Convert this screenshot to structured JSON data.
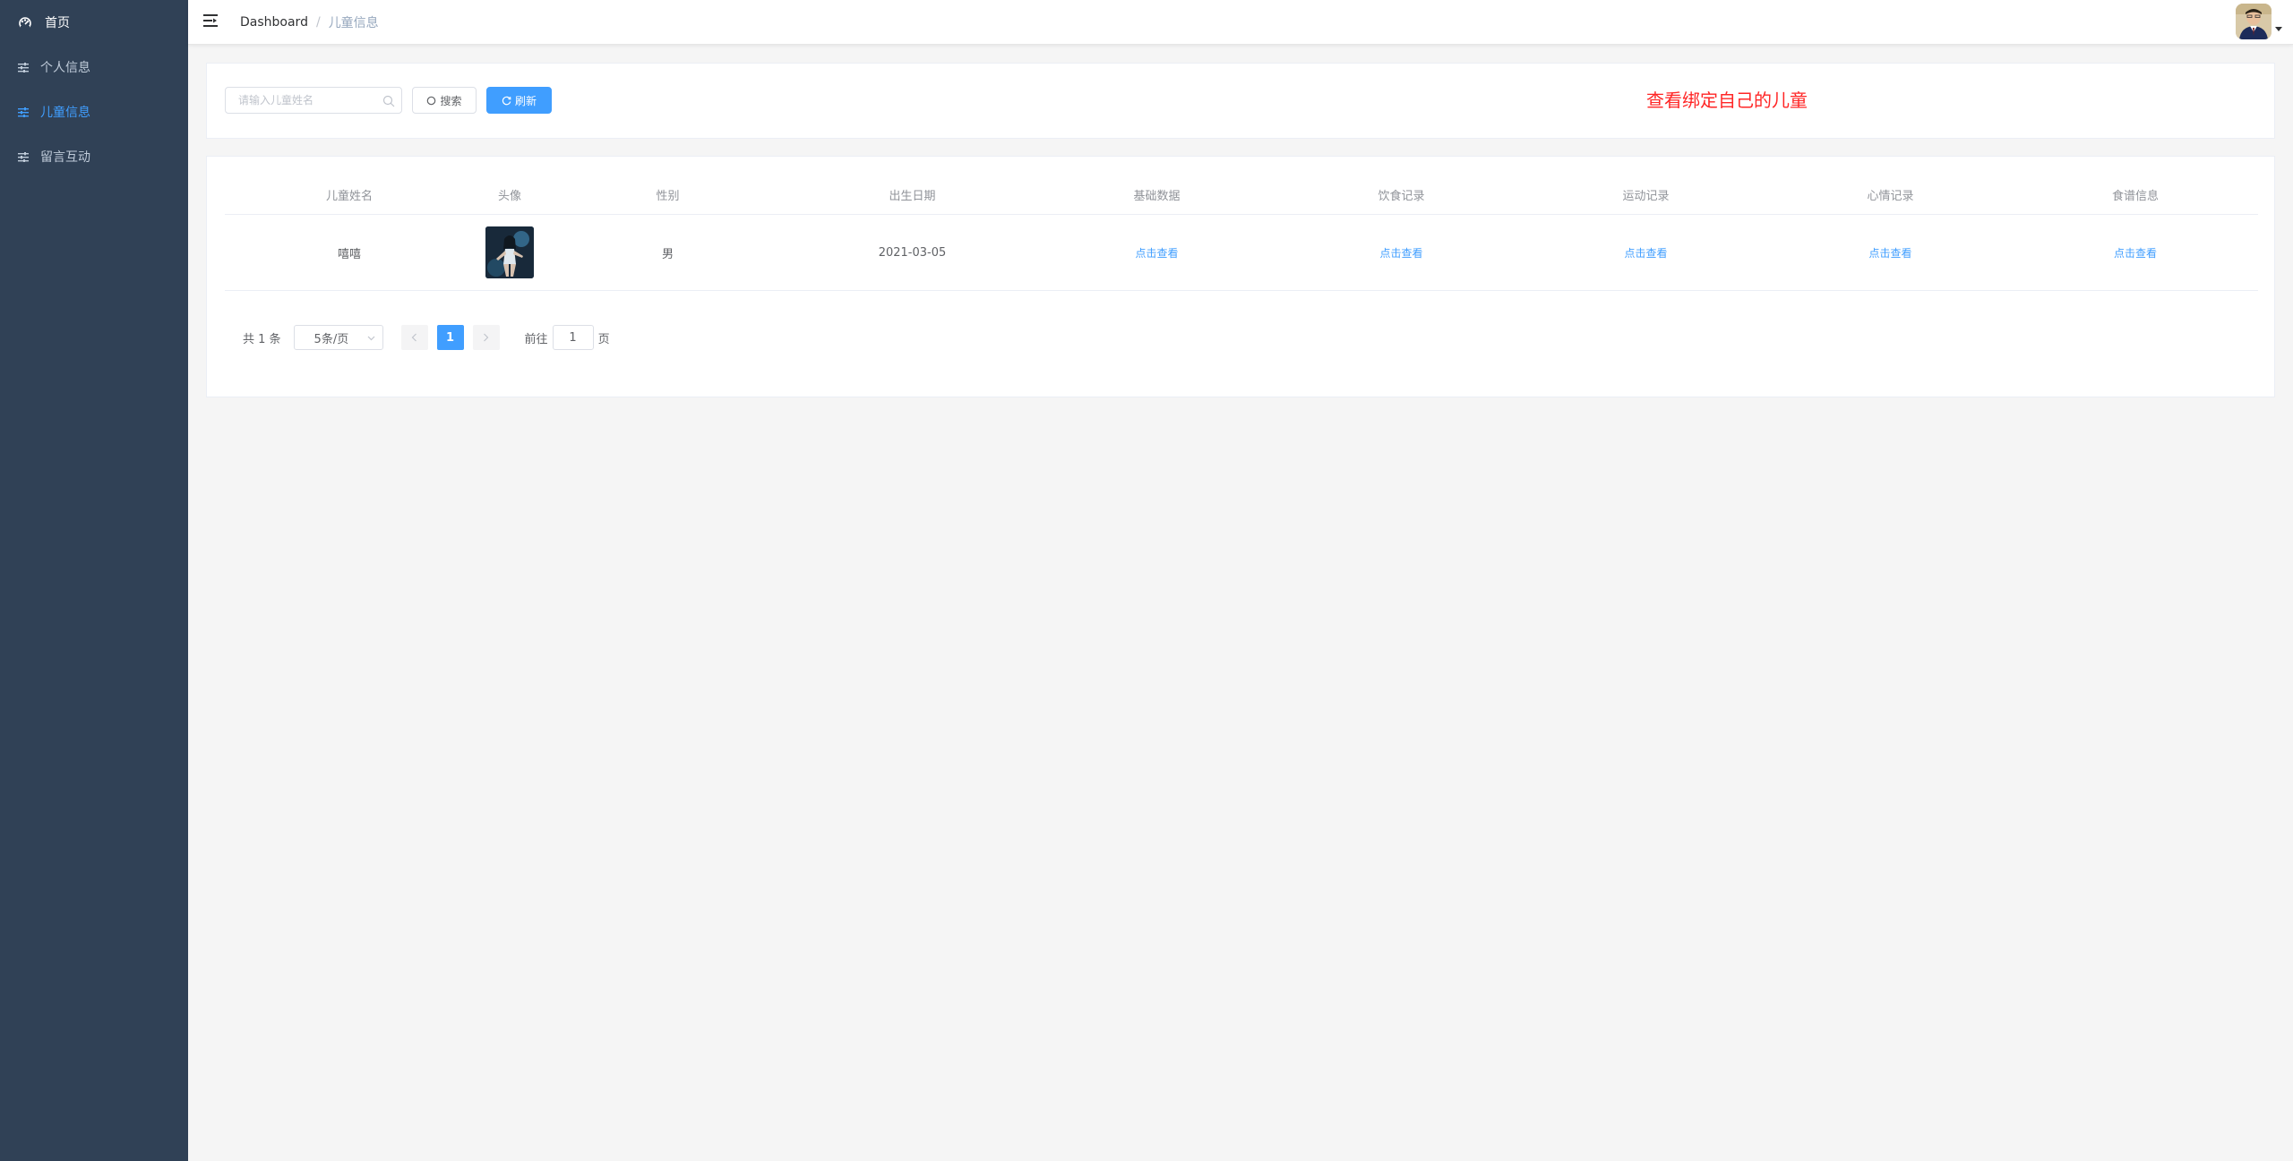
{
  "sidebar": {
    "items": [
      {
        "label": "首页",
        "icon": "dashboard-icon",
        "active": false
      },
      {
        "label": "个人信息",
        "icon": "sliders-icon",
        "active": false
      },
      {
        "label": "儿童信息",
        "icon": "sliders-icon",
        "active": true
      },
      {
        "label": "留言互动",
        "icon": "sliders-icon",
        "active": false
      }
    ]
  },
  "navbar": {
    "breadcrumb": {
      "home": "Dashboard",
      "separator": "/",
      "current": "儿童信息"
    }
  },
  "filter": {
    "search_placeholder": "请输入儿童姓名",
    "search_button": "搜索",
    "refresh_button": "刷新",
    "notice": "查看绑定自己的儿童"
  },
  "table": {
    "columns": [
      "儿童姓名",
      "头像",
      "性别",
      "出生日期",
      "基础数据",
      "饮食记录",
      "运动记录",
      "心情记录",
      "食谱信息"
    ],
    "rows": [
      {
        "name": "嘻嘻",
        "gender": "男",
        "birth_date": "2021-03-05",
        "basic_data": "点击查看",
        "diet_record": "点击查看",
        "exercise_record": "点击查看",
        "mood_record": "点击查看",
        "recipe_info": "点击查看"
      }
    ]
  },
  "pagination": {
    "total_text": "共 1 条",
    "page_size": "5条/页",
    "current_page": "1",
    "goto_label": "前往",
    "goto_value": "1",
    "page_unit": "页"
  },
  "colors": {
    "sidebar_bg": "#304156",
    "accent": "#409eff",
    "notice": "#ff2626"
  }
}
